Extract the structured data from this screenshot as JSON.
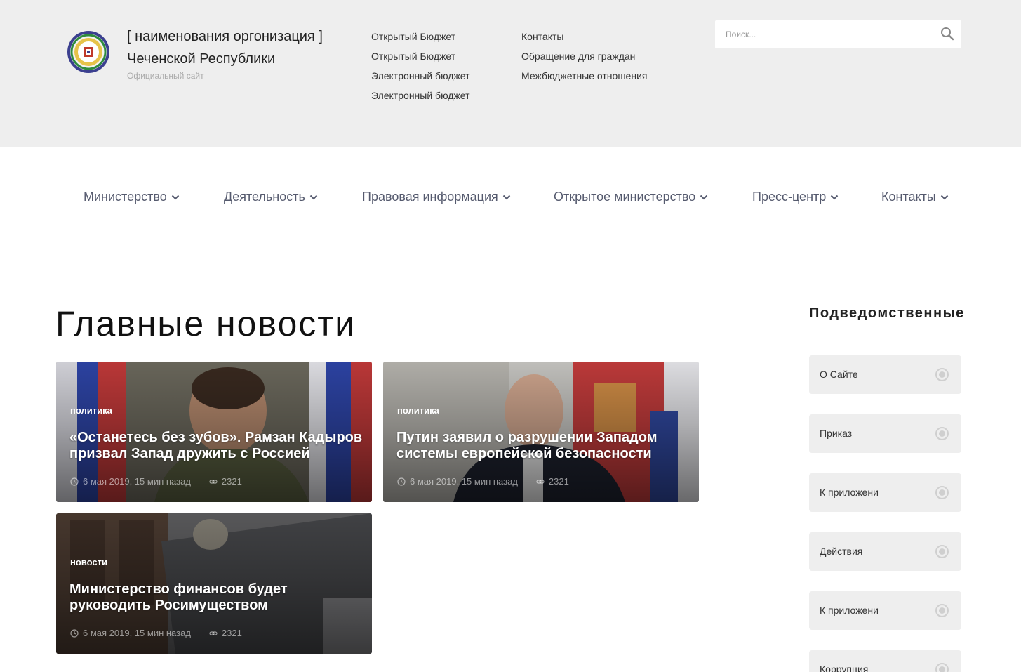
{
  "header": {
    "org_title_line1": "[ наименования оргонизация ]",
    "org_title_line2": "Чеченской Республики",
    "org_subtitle": "Официальный сайт",
    "quick_links_col1": [
      "Открытый Бюджет",
      "Открытый Бюджет",
      "Электронный бюджет",
      "Электронный бюджет"
    ],
    "quick_links_col2": [
      "Контакты",
      "Обращение для граждан",
      "Межбюджетные отношения"
    ],
    "search_placeholder": "Поиск..."
  },
  "nav": {
    "items": [
      "Министерство",
      "Деятельность",
      "Правовая информация",
      "Открытое министерство",
      "Пресс-центр",
      "Контакты"
    ]
  },
  "main": {
    "title": "Главные новости",
    "news": [
      {
        "category": "политика",
        "headline": "«Останетесь без зубов». Рамзан Кадыров призвал Запад дружить с Россией",
        "date": "6 мая 2019, 15 мин назад",
        "views": "2321"
      },
      {
        "category": "политика",
        "headline": "Путин заявил о разрушении Западом системы европейской безопасности",
        "date": "6 мая 2019, 15 мин назад",
        "views": "2321"
      },
      {
        "category": "новости",
        "headline": "Министерство финансов будет руководить Росимуществом",
        "date": "6 мая 2019, 15 мин назад",
        "views": "2321"
      }
    ]
  },
  "sidebar": {
    "title": "Подведомственные",
    "items": [
      "О Сайте",
      "Приказ",
      "К приложени",
      "Действия",
      "К приложени",
      "Коррупция"
    ]
  },
  "colors": {
    "header_bg": "#eeeeee",
    "nav_text": "#555a6e",
    "sidebar_item_bg": "#eeeeee"
  }
}
